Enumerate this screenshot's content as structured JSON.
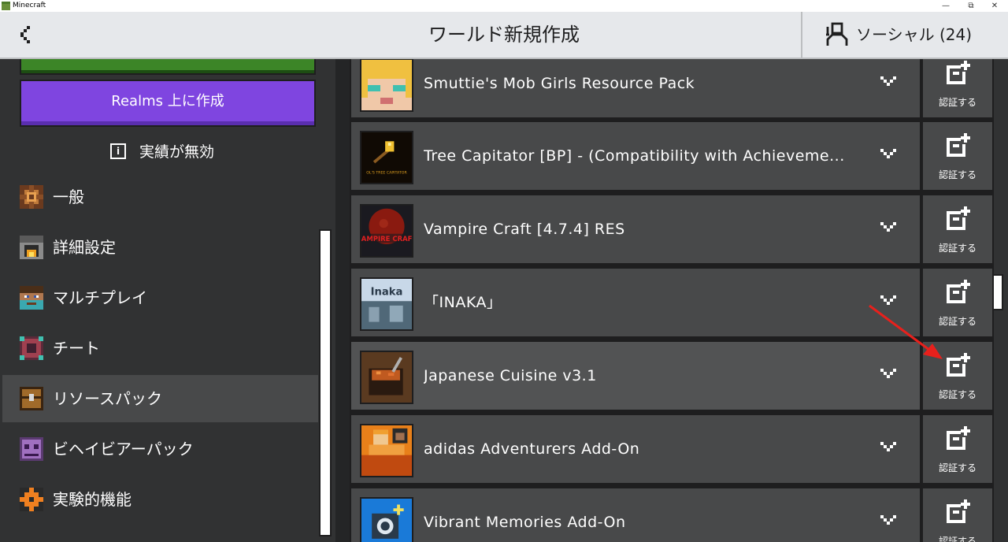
{
  "window": {
    "app_title": "Minecraft",
    "min_label": "—",
    "max_label": "⧉",
    "close_label": "✕"
  },
  "header": {
    "title": "ワールド新規作成",
    "social_label": "ソーシャル (24)",
    "back_icon": "chevron-left-icon",
    "social_icon": "people-icon"
  },
  "left_panel": {
    "realms_button": "Realms 上に作成",
    "achievements_icon_glyph": "i",
    "achievements_text": "実績が無効",
    "nav": [
      {
        "label": "一般",
        "icon": "gear-block-icon",
        "selected": false
      },
      {
        "label": "詳細設定",
        "icon": "furnace-icon",
        "selected": false
      },
      {
        "label": "マルチプレイ",
        "icon": "player-head-icon",
        "selected": false
      },
      {
        "label": "チート",
        "icon": "command-block-icon",
        "selected": false
      },
      {
        "label": "リソースパック",
        "icon": "chest-icon",
        "selected": true
      },
      {
        "label": "ビヘイビアーパック",
        "icon": "behavior-icon",
        "selected": false
      },
      {
        "label": "実験的機能",
        "icon": "experiment-icon",
        "selected": false
      }
    ]
  },
  "packs": [
    {
      "name": "Smuttie's Mob Girls Resource Pack",
      "action": "認証する",
      "thumb": "anime-face"
    },
    {
      "name": "Tree Capitator [BP] - (Compatibility with Achieveme...",
      "action": "認証する",
      "thumb": "golden-axe",
      "thumb_caption": "OL'S TREE CAPITATOR"
    },
    {
      "name": "Vampire Craft [4.7.4] RES",
      "action": "認証する",
      "thumb": "blood-moon",
      "thumb_caption": "VAMPIRE CRAFT"
    },
    {
      "name": "「INAKA」",
      "action": "認証する",
      "thumb": "inaka",
      "thumb_caption": "Inaka"
    },
    {
      "name": "Japanese Cuisine v3.1",
      "action": "認証する",
      "thumb": "food-bowl"
    },
    {
      "name": "adidas Adventurers Add-On",
      "action": "認証する",
      "thumb": "adventurers"
    },
    {
      "name": "Vibrant Memories Add-On",
      "action": "認証する",
      "thumb": "camera"
    }
  ],
  "colors": {
    "realms_purple": "#7f45e0",
    "create_green": "#3c8527",
    "annotation_arrow": "#e8201c"
  }
}
